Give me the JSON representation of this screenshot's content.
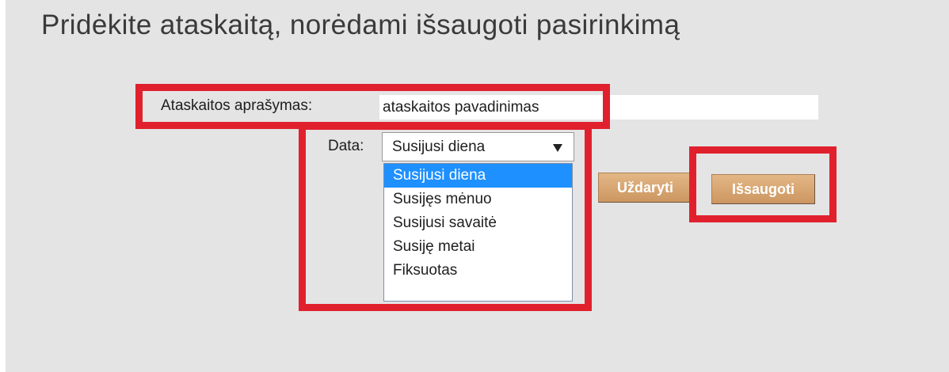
{
  "page": {
    "title": "Pridėkite ataskaitą, norėdami išsaugoti pasirinkimą"
  },
  "form": {
    "description_label": "Ataskaitos aprašymas:",
    "description_value": "ataskaitos pavadinimas",
    "date_label": "Data:",
    "date_selected": "Susijusi diena",
    "date_options": [
      "Susijusi diena",
      "Susijęs mėnuo",
      "Susijusi savaitė",
      "Susiję metai",
      "Fiksuotas"
    ]
  },
  "actions": {
    "close_label": "Uždaryti",
    "save_label": "Išsaugoti"
  },
  "colors": {
    "background": "#e4e4e4",
    "button": "#d8a873",
    "selected_option": "#1e90ff",
    "highlight": "#e0212d"
  }
}
